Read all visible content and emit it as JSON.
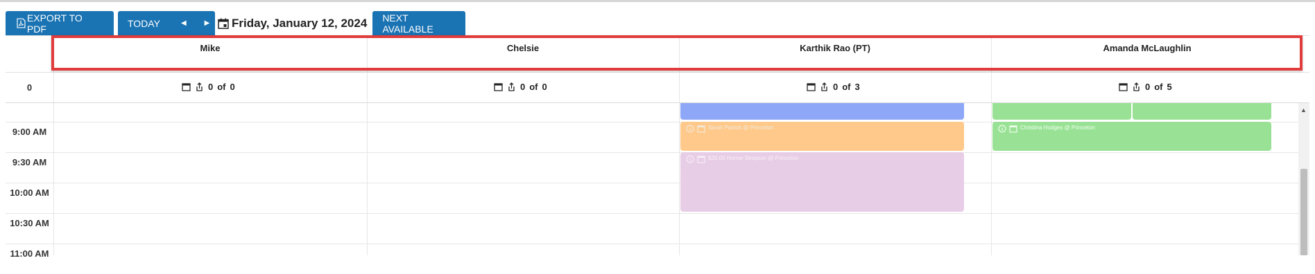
{
  "toolbar": {
    "export_label": "EXPORT TO PDF",
    "today_label": "TODAY",
    "prev_icon": "triangle-left",
    "next_icon": "triangle-right",
    "date": "Friday, January 12, 2024",
    "next_available_label": "NEXT AVAILABLE"
  },
  "header": {
    "corner_count": "0",
    "providers": [
      {
        "name": "Mike",
        "booked": "0",
        "of_label": "of",
        "total": "0"
      },
      {
        "name": "Chelsie",
        "booked": "0",
        "of_label": "of",
        "total": "0"
      },
      {
        "name": "Karthik Rao (PT)",
        "booked": "0",
        "of_label": "of",
        "total": "3"
      },
      {
        "name": "Amanda McLaughlin",
        "booked": "0",
        "of_label": "of",
        "total": "5"
      }
    ]
  },
  "time_slots": [
    "9:00 AM",
    "9:30 AM",
    "10:00 AM",
    "10:30 AM",
    "11:00 AM"
  ],
  "appointments": [
    {
      "provider": "Karthik Rao (PT)",
      "text": "Sarah Patrick @ Princeton",
      "color": "#fec98a"
    },
    {
      "provider": "Karthik Rao (PT)",
      "text": "$20.00 Homer Simpson @ Princeton",
      "color": "#e8cde6"
    },
    {
      "provider": "Amanda McLaughlin",
      "text": "Christina Hodges @ Princeton",
      "color": "#99e295"
    }
  ],
  "colors": {
    "button": "#1a73b3",
    "highlight": "#e23b3b",
    "blue_block": "#8ea8f7"
  }
}
